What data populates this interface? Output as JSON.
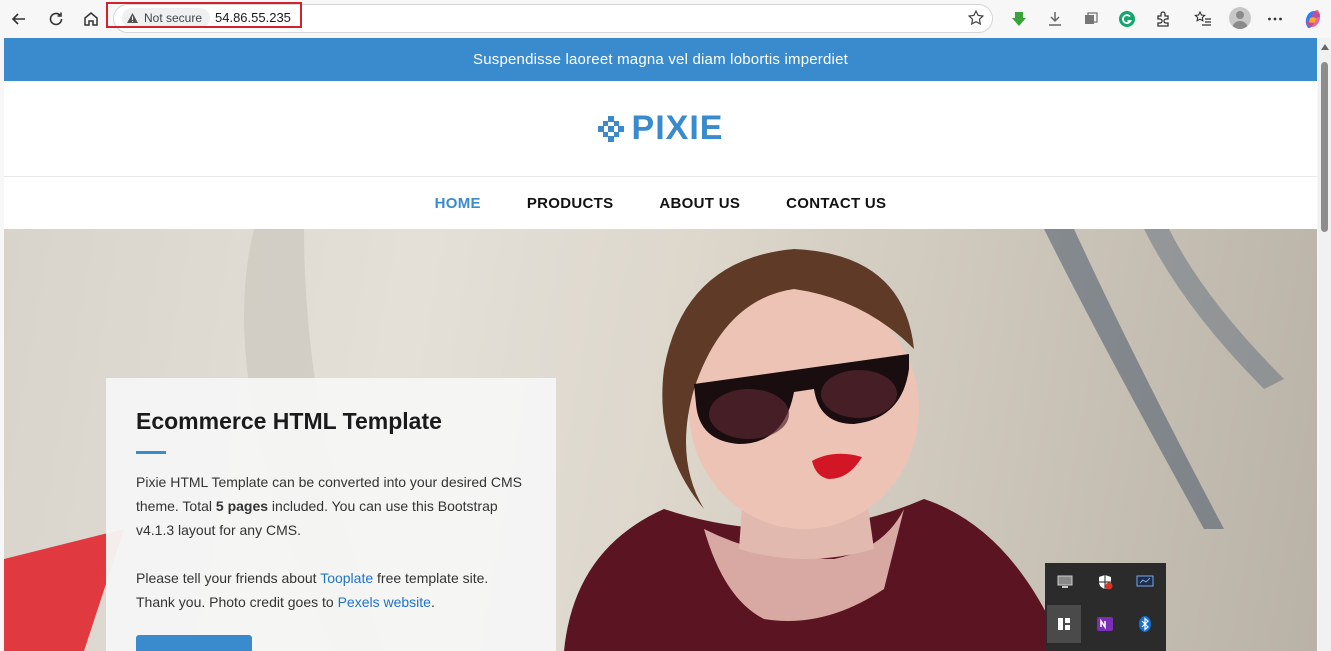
{
  "browser": {
    "security_label": "Not secure",
    "url": "54.86.55.235"
  },
  "site": {
    "announcement": "Suspendisse laoreet magna vel diam lobortis imperdiet",
    "logo": "PIXIE",
    "nav": [
      {
        "label": "HOME",
        "active": true
      },
      {
        "label": "PRODUCTS",
        "active": false
      },
      {
        "label": "ABOUT US",
        "active": false
      },
      {
        "label": "CONTACT US",
        "active": false
      }
    ],
    "hero": {
      "title": "Ecommerce HTML Template",
      "p1_a": "Pixie HTML Template can be converted into your desired CMS theme. Total ",
      "p1_bold": "5 pages",
      "p1_b": " included. You can use this Bootstrap v4.1.3 layout for any CMS.",
      "p2_a": "Please tell your friends about ",
      "p2_link": "Tooplate",
      "p2_b": " free template site.",
      "p3_a": "Thank you. Photo credit goes to ",
      "p3_link": "Pexels website",
      "p3_b": "."
    }
  },
  "colors": {
    "accent": "#3a8bcd",
    "highlight": "#d0232b"
  },
  "tray_icons": [
    "monitor-icon",
    "shield-icon",
    "display-icon",
    "snip-icon",
    "onenote-icon",
    "bluetooth-icon"
  ]
}
